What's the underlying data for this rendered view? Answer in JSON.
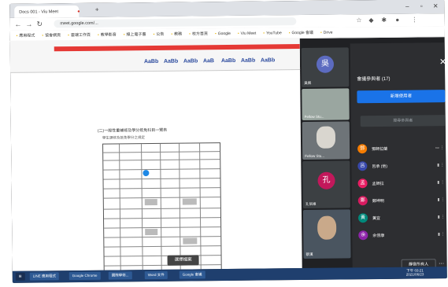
{
  "browser": {
    "tabs": [
      {
        "label": "Docs 001 - Viu Meet"
      },
      {
        "label": "Google Meet"
      }
    ],
    "url": "meet.google.com/...",
    "bookmarks": [
      "應用程式",
      "協會網頁",
      "雲端工作頁",
      "教學影音",
      "線上電子書",
      "公告",
      "教務",
      "校方首頁",
      "Google",
      "Viu Meet",
      "YouTube",
      "Google 會議",
      "Drive",
      "Google 雲端硬碟"
    ]
  },
  "doc": {
    "ribbon_styles": [
      "AaBb",
      "AaBb",
      "AaBb",
      "AaB",
      "AaBb",
      "AaBb",
      "AaBb"
    ],
    "title": "(二)一般性重補修及學分抵免科目一覽表",
    "subtitle": "學生選修及抵免學分之規定",
    "button": "選擇檔案"
  },
  "tiles": [
    {
      "name": "吳佩",
      "avatar": "吳",
      "color": "#5c6bc0"
    },
    {
      "name": "Fellow Stu...",
      "avatar": "",
      "color": "#3c4043"
    },
    {
      "name": "Fellow Stu...",
      "avatar": "",
      "color": "#3c4043"
    },
    {
      "name": "孔信維",
      "avatar": "孔",
      "color": "#c2185b"
    },
    {
      "name": "蔡漢",
      "avatar": "",
      "color": "#3c4043"
    }
  ],
  "panel": {
    "title": "會議參與者 (17)",
    "add_label": "新增使用者",
    "search_placeholder": "搜尋參與者",
    "people": [
      {
        "name": "鄧師拉蘭",
        "avatar": "鄧",
        "color": "#f57c00"
      },
      {
        "name": "呂承 (他)",
        "avatar": "呂",
        "color": "#3949ab"
      },
      {
        "name": "孟師拉",
        "avatar": "孟",
        "color": "#e91e63"
      },
      {
        "name": "鄭坤明",
        "avatar": "鄭",
        "color": "#d81b60"
      },
      {
        "name": "黃宜",
        "avatar": "黃",
        "color": "#00897b"
      },
      {
        "name": "余佳康",
        "avatar": "余",
        "color": "#8e24aa"
      }
    ],
    "all_button": "靜音所有人",
    "more": "⋯"
  },
  "taskbar": {
    "items": [
      "LINE 應用程式",
      "Google Chrome",
      "國際學術...",
      "Word 文件",
      "Google 會議"
    ],
    "time": "下午 03:21",
    "date": "2021/06/23"
  }
}
